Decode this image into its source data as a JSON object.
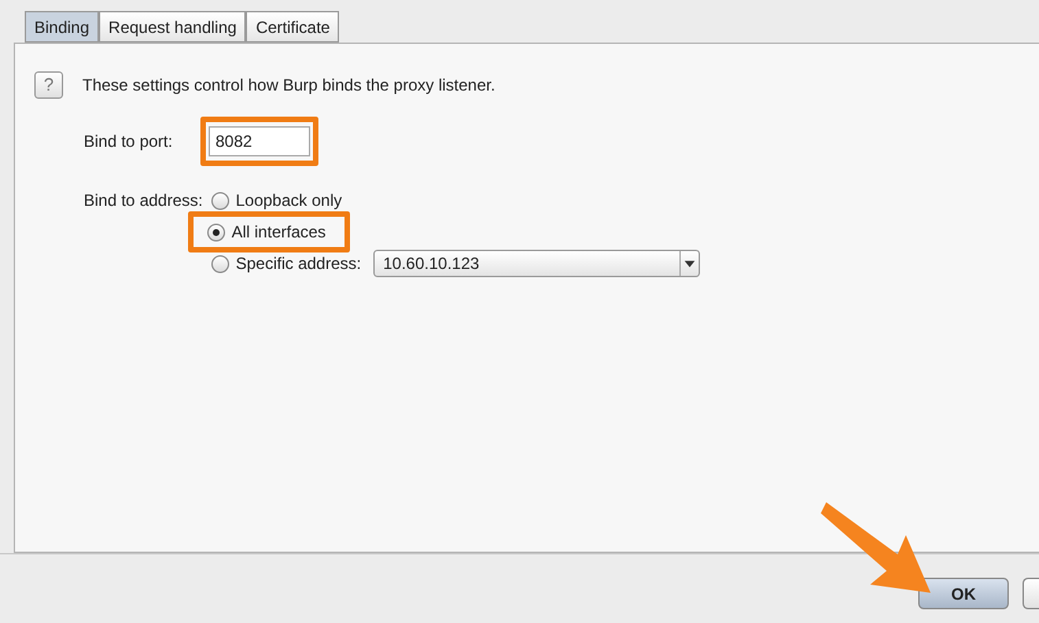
{
  "tabs": [
    {
      "label": "Binding",
      "selected": true
    },
    {
      "label": "Request handling",
      "selected": false
    },
    {
      "label": "Certificate",
      "selected": false
    }
  ],
  "help": {
    "icon_text": "?",
    "text": "These settings control how Burp binds the proxy listener."
  },
  "port": {
    "label": "Bind to port:",
    "value": "8082",
    "highlighted": true
  },
  "address": {
    "label": "Bind to address:",
    "options": [
      {
        "label": "Loopback only",
        "selected": false,
        "highlighted": false
      },
      {
        "label": "All interfaces",
        "selected": true,
        "highlighted": true
      },
      {
        "label": "Specific address:",
        "selected": false,
        "highlighted": false,
        "dropdown_value": "10.60.10.123"
      }
    ]
  },
  "buttons": [
    {
      "label": "OK"
    }
  ]
}
